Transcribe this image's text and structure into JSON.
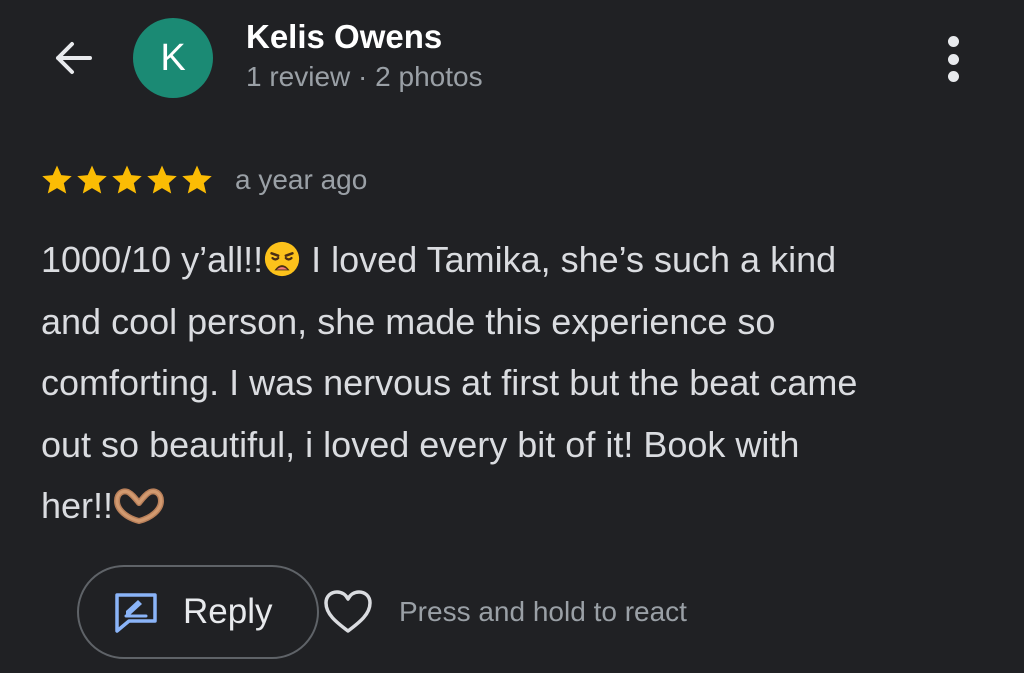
{
  "header": {
    "back_icon": "arrow-back-icon",
    "avatar_letter": "K",
    "avatar_color": "#1b8a74",
    "name": "Kelis Owens",
    "meta": "1 review · 2 photos",
    "more_icon": "more-vertical-icon"
  },
  "review": {
    "rating": 5,
    "rating_max": 5,
    "star_color": "#fbbc04",
    "time": "a year ago",
    "lines": [
      {
        "text": "1000/10 y’all!!",
        "emoji": "weary-face-emoji",
        "after": " I loved Tamika, she’s such a kind"
      },
      {
        "text": "and cool person, she made this experience so"
      },
      {
        "text": "comforting. I was nervous at first but the beat came"
      },
      {
        "text": "out so beautiful, i loved every bit of it! Book with"
      },
      {
        "text": "her!!",
        "emoji": "heart-hands-emoji"
      }
    ]
  },
  "actions": {
    "reply_icon": "reply-edit-icon",
    "reply_label": "Reply",
    "react_icon": "heart-outline-icon",
    "react_hint": "Press and hold to react",
    "accent": "#8ab4f8"
  }
}
